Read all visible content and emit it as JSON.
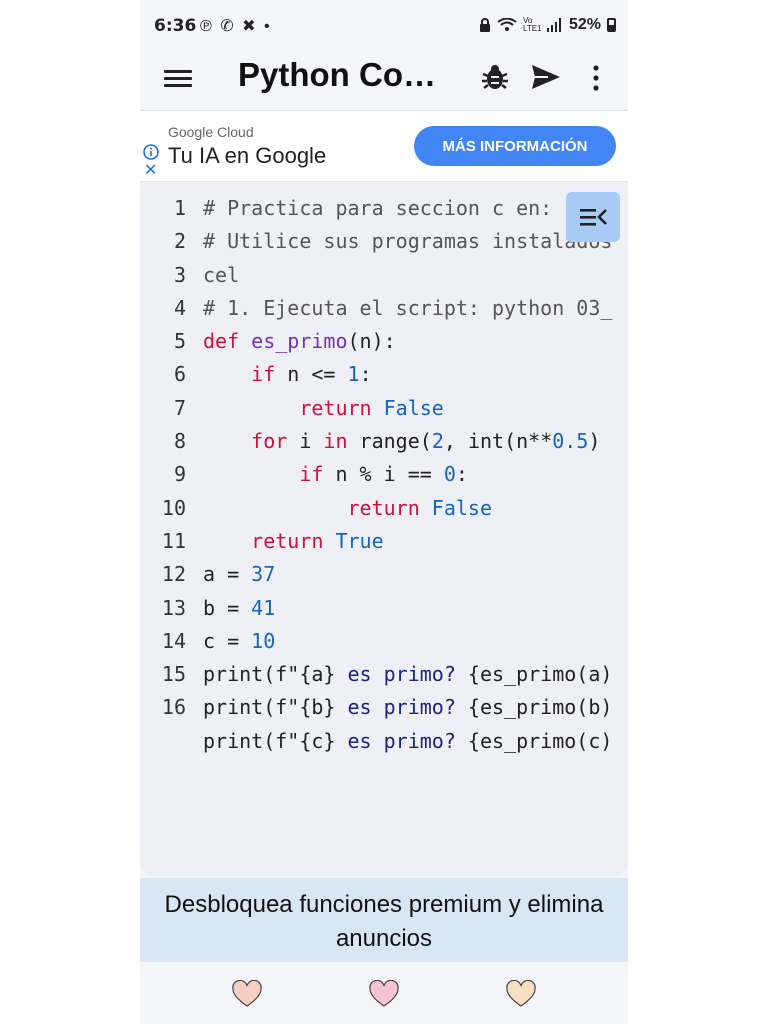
{
  "status_bar": {
    "time": "6:36",
    "left_icons": "℗ ✆ ✖ •",
    "network_text": "Vo LTE1",
    "battery": "52%"
  },
  "app_bar": {
    "title": "Python Cod..."
  },
  "ad": {
    "source": "Google Cloud",
    "title": "Tu IA en Google",
    "button_label": "MÁS INFORMACIÓN",
    "close_glyph": "✕"
  },
  "editor": {
    "line_numbers": [
      "1",
      "2",
      "3",
      "4",
      "5",
      "6",
      "7",
      "8",
      "9",
      "10",
      "11",
      "12",
      "13",
      "14",
      "15",
      "16",
      ""
    ],
    "lines": [
      [
        {
          "t": "# Practica para seccion c en:",
          "c": "cmt"
        }
      ],
      [
        {
          "t": "# Utilice sus programas instalados",
          "c": "cmt"
        }
      ],
      [
        {
          "t": "cel",
          "c": "cmt"
        }
      ],
      [
        {
          "t": "# 1. Ejecuta el script: python 03_",
          "c": "cmt"
        }
      ],
      [
        {
          "t": "def ",
          "c": "kw"
        },
        {
          "t": "es_primo",
          "c": "fn"
        },
        {
          "t": "(n):",
          "c": "tx"
        }
      ],
      [
        {
          "t": "    ",
          "c": "tx"
        },
        {
          "t": "if",
          "c": "kw"
        },
        {
          "t": " n <= ",
          "c": "tx"
        },
        {
          "t": "1",
          "c": "num"
        },
        {
          "t": ":",
          "c": "tx"
        }
      ],
      [
        {
          "t": "        ",
          "c": "tx"
        },
        {
          "t": "return",
          "c": "kw"
        },
        {
          "t": " ",
          "c": "tx"
        },
        {
          "t": "False",
          "c": "lit"
        }
      ],
      [
        {
          "t": "    ",
          "c": "tx"
        },
        {
          "t": "for",
          "c": "kw"
        },
        {
          "t": " i ",
          "c": "tx"
        },
        {
          "t": "in",
          "c": "kw"
        },
        {
          "t": " range(",
          "c": "tx"
        },
        {
          "t": "2",
          "c": "num"
        },
        {
          "t": ", int(n**",
          "c": "tx"
        },
        {
          "t": "0.5",
          "c": "num"
        },
        {
          "t": ")",
          "c": "tx"
        }
      ],
      [
        {
          "t": "        ",
          "c": "tx"
        },
        {
          "t": "if",
          "c": "kw"
        },
        {
          "t": " n % i == ",
          "c": "tx"
        },
        {
          "t": "0",
          "c": "num"
        },
        {
          "t": ":",
          "c": "tx"
        }
      ],
      [
        {
          "t": "            ",
          "c": "tx"
        },
        {
          "t": "return",
          "c": "kw"
        },
        {
          "t": " ",
          "c": "tx"
        },
        {
          "t": "False",
          "c": "lit"
        }
      ],
      [
        {
          "t": "    ",
          "c": "tx"
        },
        {
          "t": "return",
          "c": "kw"
        },
        {
          "t": " ",
          "c": "tx"
        },
        {
          "t": "True",
          "c": "lit"
        }
      ],
      [
        {
          "t": "a = ",
          "c": "tx"
        },
        {
          "t": "37",
          "c": "num"
        }
      ],
      [
        {
          "t": "b = ",
          "c": "tx"
        },
        {
          "t": "41",
          "c": "num"
        }
      ],
      [
        {
          "t": "c = ",
          "c": "tx"
        },
        {
          "t": "10",
          "c": "num"
        }
      ],
      [
        {
          "t": "print(f\"{a} ",
          "c": "tx"
        },
        {
          "t": "es primo?",
          "c": "str"
        },
        {
          "t": " {es_primo(a)",
          "c": "tx"
        }
      ],
      [
        {
          "t": "print(f\"{b} ",
          "c": "tx"
        },
        {
          "t": "es primo?",
          "c": "str"
        },
        {
          "t": " {es_primo(b)",
          "c": "tx"
        }
      ],
      [
        {
          "t": "print(f\"{c} ",
          "c": "tx"
        },
        {
          "t": "es primo?",
          "c": "str"
        },
        {
          "t": " {es_primo(c)",
          "c": "tx"
        }
      ]
    ]
  },
  "premium_banner": {
    "text": "Desbloquea funciones premium y elimina anuncios"
  },
  "colors": {
    "keyword": "#d0103a",
    "function": "#7a2fb8",
    "number": "#1565c0",
    "ad_button": "#4285f4",
    "heart_1": "#f6cfc0",
    "heart_2": "#f6c3d2",
    "heart_3": "#f8dfc4"
  },
  "icons": {
    "menu": "hamburger-icon",
    "debug": "bug-icon",
    "run": "send-icon",
    "more": "more-vert-icon",
    "outline": "outline-list-icon",
    "nav": [
      "heart-icon",
      "heart-icon",
      "heart-icon"
    ]
  }
}
